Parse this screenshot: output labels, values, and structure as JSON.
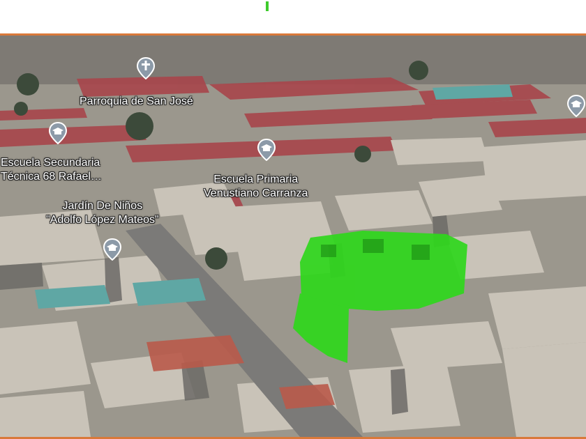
{
  "top_indicator_color": "#3ecb2c",
  "accent_line_color": "#d9793a",
  "highlight_color": "#2fd71c",
  "places": [
    {
      "id": "parroquia",
      "lines": [
        "Parroquia de San José"
      ],
      "icon": "place-of-worship-pin-icon"
    },
    {
      "id": "sec68",
      "lines": [
        "Escuela Secundaria",
        "Técnica 68 Rafael…"
      ],
      "icon": "school-pin-icon"
    },
    {
      "id": "primaria",
      "lines": [
        "Escuela Primaria",
        "Venustiano Carranza"
      ],
      "icon": "school-pin-icon"
    },
    {
      "id": "jardin",
      "lines": [
        "Jardín De Niños",
        "\"Adolfo López Mateos\""
      ],
      "icon": "school-pin-icon"
    }
  ],
  "unlabeled_pins": [
    {
      "id": "right-edge",
      "icon": "school-pin-icon"
    }
  ]
}
